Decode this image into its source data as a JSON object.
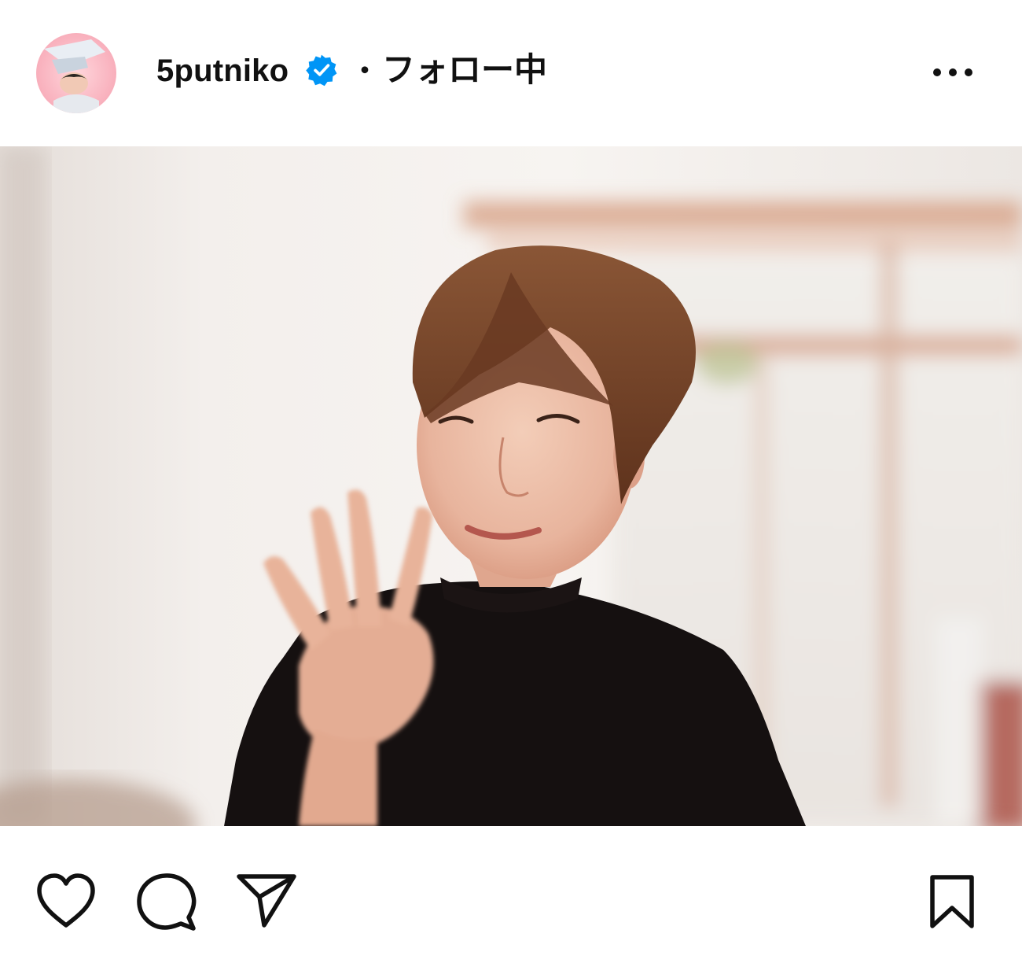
{
  "header": {
    "username": "5putniko",
    "separator": "・",
    "follow_status": "フォロー中",
    "verified_icon": "verified-badge-icon",
    "more_icon": "more-horizontal-icon"
  },
  "post": {
    "image_icon": "post-photo"
  },
  "actions": {
    "like_icon": "heart-icon",
    "comment_icon": "comment-bubble-icon",
    "share_icon": "paper-plane-icon",
    "save_icon": "bookmark-icon"
  },
  "colors": {
    "verified_blue": "#0095f6",
    "text": "#111111",
    "background": "#ffffff"
  }
}
